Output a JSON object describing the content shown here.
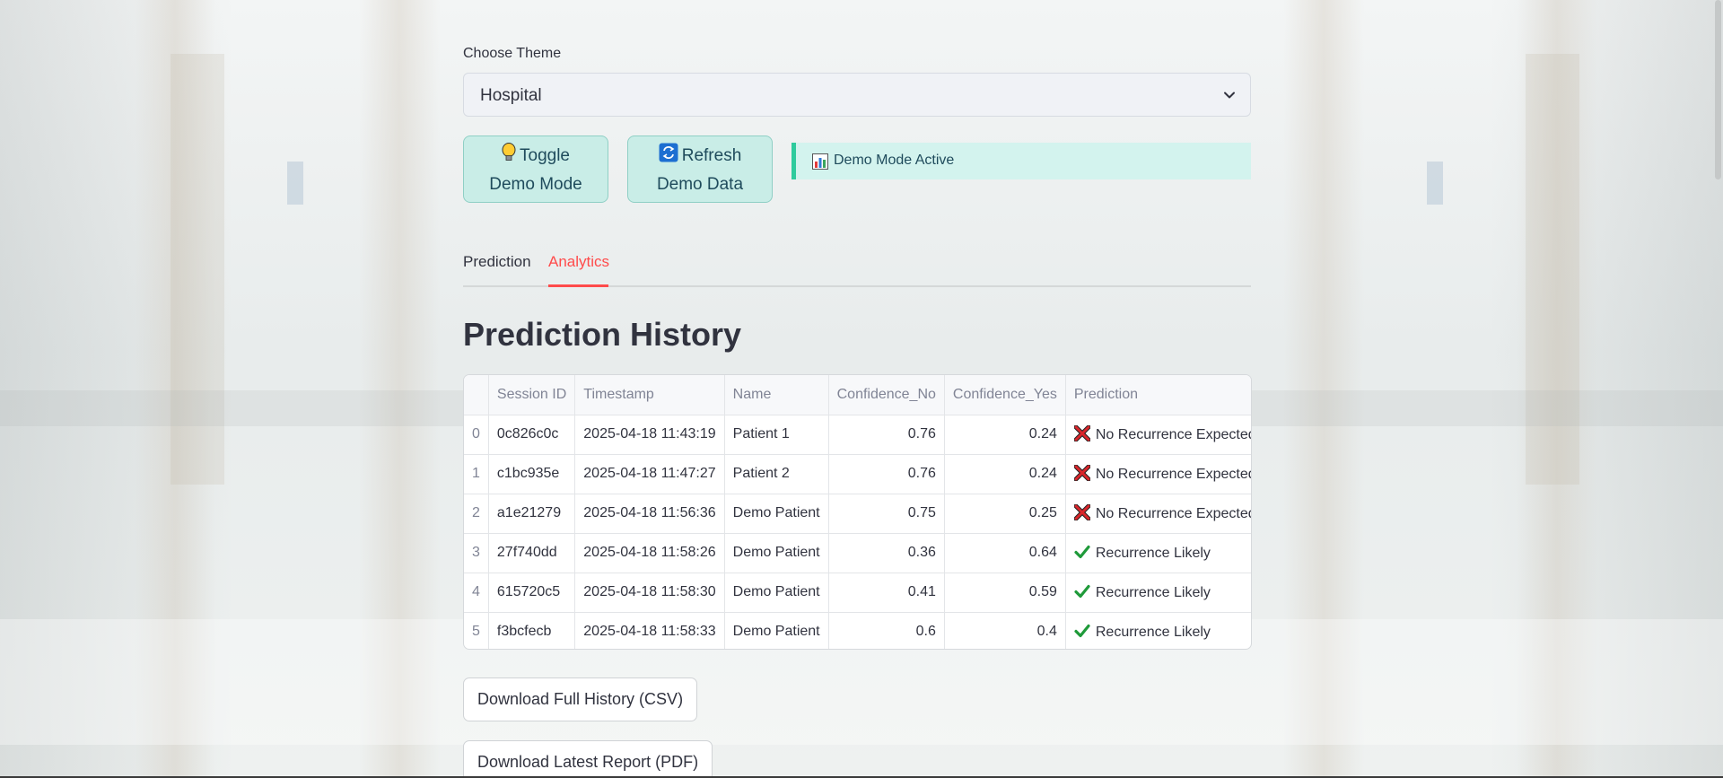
{
  "theme": {
    "label": "Choose Theme",
    "selected": "Hospital"
  },
  "buttons": {
    "toggle_line1": "Toggle",
    "toggle_line2": "Demo Mode",
    "refresh_line1": "Refresh",
    "refresh_line2": "Demo Data"
  },
  "alert": {
    "text": "Demo Mode Active"
  },
  "tabs": [
    {
      "label": "Prediction",
      "active": false
    },
    {
      "label": "Analytics",
      "active": true
    }
  ],
  "heading": "Prediction History",
  "table": {
    "headers": [
      "",
      "Session ID",
      "Timestamp",
      "Name",
      "Confidence_No",
      "Confidence_Yes",
      "Prediction"
    ],
    "rows": [
      {
        "idx": "0",
        "session": "0c826c0c",
        "timestamp": "2025-04-18 11:43:19",
        "name": "Patient 1",
        "conf_no": "0.76",
        "conf_yes": "0.24",
        "prediction": "No Recurrence Expected",
        "icon": "cross-icon"
      },
      {
        "idx": "1",
        "session": "c1bc935e",
        "timestamp": "2025-04-18 11:47:27",
        "name": "Patient 2",
        "conf_no": "0.76",
        "conf_yes": "0.24",
        "prediction": "No Recurrence Expected",
        "icon": "cross-icon"
      },
      {
        "idx": "2",
        "session": "a1e21279",
        "timestamp": "2025-04-18 11:56:36",
        "name": "Demo Patient",
        "conf_no": "0.75",
        "conf_yes": "0.25",
        "prediction": "No Recurrence Expected",
        "icon": "cross-icon"
      },
      {
        "idx": "3",
        "session": "27f740dd",
        "timestamp": "2025-04-18 11:58:26",
        "name": "Demo Patient",
        "conf_no": "0.36",
        "conf_yes": "0.64",
        "prediction": "Recurrence Likely",
        "icon": "check-icon"
      },
      {
        "idx": "4",
        "session": "615720c5",
        "timestamp": "2025-04-18 11:58:30",
        "name": "Demo Patient",
        "conf_no": "0.41",
        "conf_yes": "0.59",
        "prediction": "Recurrence Likely",
        "icon": "check-icon"
      },
      {
        "idx": "5",
        "session": "f3bcfecb",
        "timestamp": "2025-04-18 11:58:33",
        "name": "Demo Patient",
        "conf_no": "0.6",
        "conf_yes": "0.4",
        "prediction": "Recurrence Likely",
        "icon": "check-icon"
      }
    ]
  },
  "downloads": {
    "csv": "Download Full History (CSV)",
    "pdf": "Download Latest Report (PDF)"
  },
  "colors": {
    "accent": "#ff4b4b",
    "demo_button": "#c9ede7",
    "alert_bar": "#2ecb9d"
  }
}
